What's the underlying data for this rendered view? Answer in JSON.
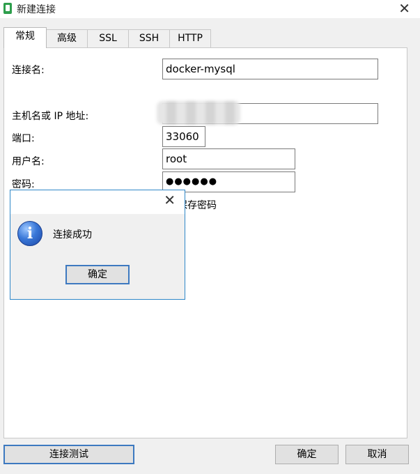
{
  "window": {
    "title": "新建连接",
    "close_glyph": "✕",
    "icon": "navicat-app-icon"
  },
  "tabs": [
    {
      "label": "常规",
      "active": true
    },
    {
      "label": "高级",
      "active": false
    },
    {
      "label": "SSL",
      "active": false
    },
    {
      "label": "SSH",
      "active": false
    },
    {
      "label": "HTTP",
      "active": false
    }
  ],
  "form": {
    "connection_name_label": "连接名:",
    "connection_name_value": "docker-mysql",
    "host_label": "主机名或 IP 地址:",
    "host_value": "",
    "port_label": "端口:",
    "port_value": "33060",
    "user_label": "用户名:",
    "user_value": "root",
    "password_label": "密码:",
    "password_value": "●●●●●●",
    "save_password_label": "保存密码"
  },
  "buttons": {
    "test_connection": "连接测试",
    "ok": "确定",
    "cancel": "取消"
  },
  "dialog": {
    "close_glyph": "✕",
    "icon": "info-icon",
    "message": "连接成功",
    "ok_label": "确定"
  },
  "colors": {
    "focus_border": "#3d79c0",
    "dialog_border": "#2e87c8",
    "info_icon": "#3a78d8"
  }
}
